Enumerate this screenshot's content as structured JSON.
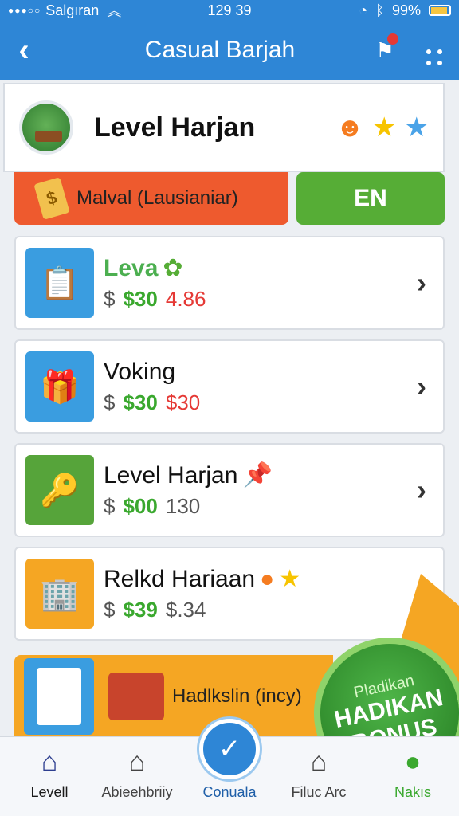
{
  "status_bar": {
    "carrier": "Salgıran",
    "time": "129 39",
    "battery": "99%"
  },
  "nav": {
    "title": "Casual Barjah"
  },
  "level_card": {
    "title": "Level Harjan"
  },
  "actions": {
    "orange_label": "Malval (Lausianiar)",
    "green_label": "EN"
  },
  "list": [
    {
      "name": "Leva",
      "price1": "$",
      "price2": "$30",
      "price3": "4.86"
    },
    {
      "name": "Voking",
      "price1": "$",
      "price2": "$30",
      "price3": "$30"
    },
    {
      "name": "Level Harjan",
      "price1": "$",
      "price2": "$00",
      "price3": "130"
    },
    {
      "name": "Relkd Hariaan",
      "price1": "$",
      "price2": "$39",
      "price3": "$.34"
    }
  ],
  "promo": {
    "label": "Hadlkslin (incy)"
  },
  "bonus": {
    "small": "Pladikan",
    "line1": "HADIKAN",
    "line2": "BONUS"
  },
  "tabs": [
    {
      "label": "Levell",
      "icon": "home-icon"
    },
    {
      "label": "Abieehbriiy",
      "icon": "house-outline-icon"
    },
    {
      "label": "Conuala",
      "icon": "check-icon"
    },
    {
      "label": "Filuc Arc",
      "icon": "house-outline-icon"
    },
    {
      "label": "Nakıs",
      "icon": "circle-icon"
    }
  ],
  "colors": {
    "primary": "#2e86d6",
    "orange": "#ee5a2e",
    "green": "#56ad36",
    "promo": "#f5a623"
  }
}
